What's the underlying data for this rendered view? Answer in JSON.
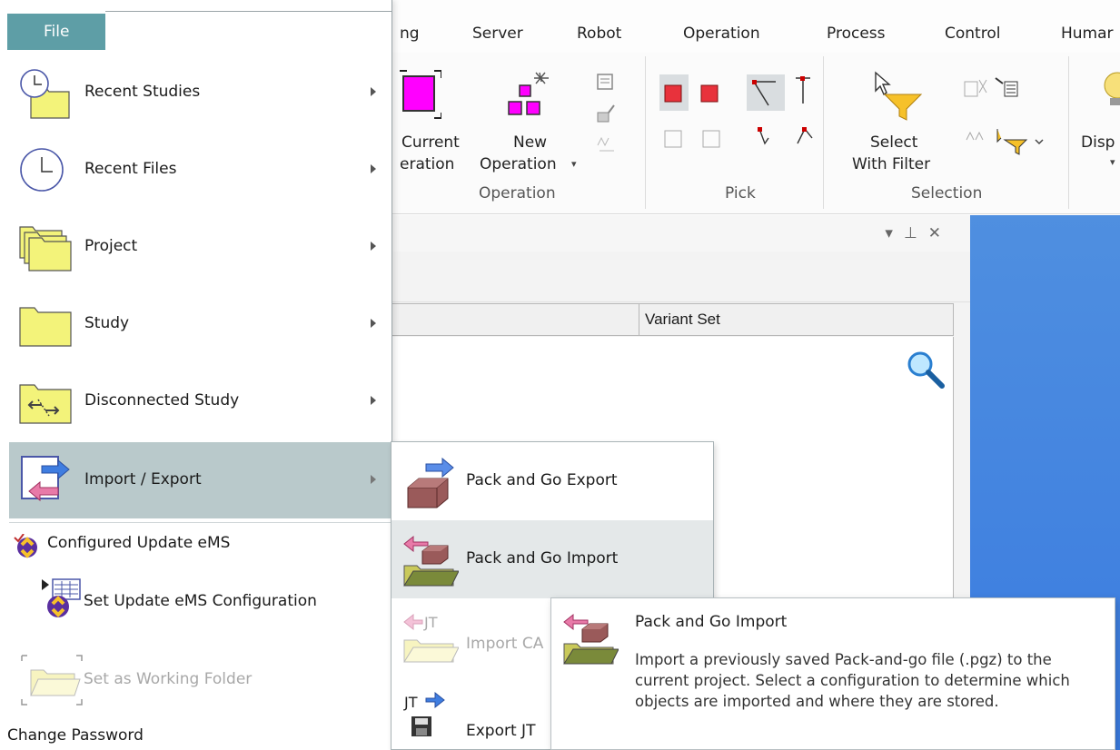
{
  "ribbon": {
    "tabs": [
      "ng",
      "Server",
      "Robot",
      "Operation",
      "Process",
      "Control",
      "Humar"
    ],
    "buttons": {
      "current_line1": "Current",
      "current_line2": "eration",
      "new_line1": "New",
      "new_line2": "Operation",
      "select_line1": "Select",
      "select_line2": "With Filter",
      "display": "Disp"
    },
    "groups": {
      "operation": "Operation",
      "pick": "Pick",
      "selection": "Selection"
    }
  },
  "panel": {
    "column_header": "Variant Set"
  },
  "file_menu": {
    "tab": "File",
    "items": [
      {
        "label": "Recent Studies"
      },
      {
        "label": "Recent Files"
      },
      {
        "label": "Project"
      },
      {
        "label": "Study"
      },
      {
        "label": "Disconnected Study"
      },
      {
        "label": "Import / Export"
      }
    ],
    "configured_update": "Configured Update eMS",
    "set_update_config": "Set Update eMS Configuration",
    "set_working_folder": "Set as Working Folder",
    "change_password": "Change Password"
  },
  "submenu": {
    "items": [
      {
        "label": "Pack and Go Export"
      },
      {
        "label": "Pack and Go Import"
      },
      {
        "label": "Import CA",
        "icon_text": "JT"
      },
      {
        "label": "Export JT",
        "icon_text": "JT"
      }
    ]
  },
  "tooltip": {
    "title": "Pack and Go Import",
    "description": "Import a previously saved Pack-and-go file (.pgz) to the current project. Select a configuration to determine which objects are imported and where they are stored."
  },
  "colors": {
    "file_tab": "#5e9ea6",
    "selected_item": "#b9c9cb",
    "folder_yellow": "#f3f37a",
    "viewport_blue": "#3a7be0"
  }
}
